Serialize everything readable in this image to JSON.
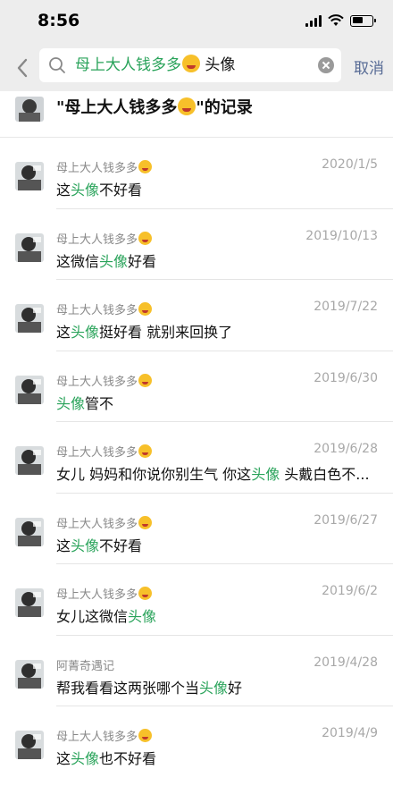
{
  "status_bar": {
    "time": "8:56"
  },
  "search": {
    "query_contact": "母上大人钱多多",
    "query_keyword": " 头像",
    "cancel_label": "取消"
  },
  "header": {
    "prefix": "\"母上大人钱多多",
    "suffix": "\"的记录"
  },
  "results": [
    {
      "sender": "母上大人钱多多",
      "emoji": true,
      "date": "2020/1/5",
      "parts": [
        [
          "这",
          false
        ],
        [
          "头像",
          true
        ],
        [
          "不好看",
          false
        ]
      ]
    },
    {
      "sender": "母上大人钱多多",
      "emoji": true,
      "date": "2019/10/13",
      "parts": [
        [
          "这微信",
          false
        ],
        [
          "头像",
          true
        ],
        [
          "好看",
          false
        ]
      ]
    },
    {
      "sender": "母上大人钱多多",
      "emoji": true,
      "date": "2019/7/22",
      "parts": [
        [
          "这",
          false
        ],
        [
          "头像",
          true
        ],
        [
          "挺好看 就别来回换了",
          false
        ]
      ]
    },
    {
      "sender": "母上大人钱多多",
      "emoji": true,
      "date": "2019/6/30",
      "parts": [
        [
          "头像",
          true
        ],
        [
          "管不",
          false
        ]
      ]
    },
    {
      "sender": "母上大人钱多多",
      "emoji": true,
      "date": "2019/6/28",
      "parts": [
        [
          "女儿 妈妈和你说你别生气 你这",
          false
        ],
        [
          "头像",
          true
        ],
        [
          " 头戴白色不...",
          false
        ]
      ]
    },
    {
      "sender": "母上大人钱多多",
      "emoji": true,
      "date": "2019/6/27",
      "parts": [
        [
          "这",
          false
        ],
        [
          "头像",
          true
        ],
        [
          "不好看",
          false
        ]
      ]
    },
    {
      "sender": "母上大人钱多多",
      "emoji": true,
      "date": "2019/6/2",
      "parts": [
        [
          "女儿这微信",
          false
        ],
        [
          "头像",
          true
        ]
      ]
    },
    {
      "sender": "阿菁奇遇记",
      "emoji": false,
      "date": "2019/4/28",
      "parts": [
        [
          "帮我看看这两张哪个当",
          false
        ],
        [
          "头像",
          true
        ],
        [
          "好",
          false
        ]
      ]
    },
    {
      "sender": "母上大人钱多多",
      "emoji": true,
      "date": "2019/4/9",
      "parts": [
        [
          "这",
          false
        ],
        [
          "头像",
          true
        ],
        [
          "也不好看",
          false
        ]
      ]
    }
  ],
  "colors": {
    "highlight": "#29a35a",
    "cancel": "#576b95"
  }
}
